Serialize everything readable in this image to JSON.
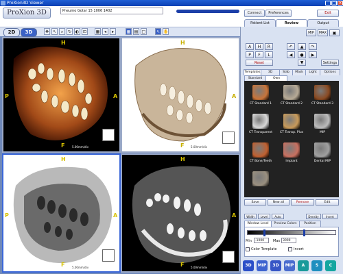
{
  "window": {
    "title": "ProXion3D Viewer",
    "controls": [
      "_",
      "□",
      "×"
    ]
  },
  "header": {
    "logo": "ProXion 3D",
    "file_path": "Pneumo Gotar 15 1006 1402",
    "buttons": {
      "connect": "Connect",
      "preferences": "Preferences",
      "exit": "Exit"
    },
    "tabs": [
      "Patient List",
      "Review",
      "Output"
    ],
    "active_tab": "Review"
  },
  "toolbar": {
    "mode_2d": "2D",
    "mode_3d": "3D"
  },
  "viewports": [
    {
      "name": "viewport-top-left",
      "top": "H",
      "left": "P",
      "right": "A",
      "bottom": "F",
      "scale": "5.00mm/div"
    },
    {
      "name": "viewport-top-right",
      "top": "H",
      "left": "",
      "right": "A",
      "bottom": "F",
      "scale": "5.00mm/div"
    },
    {
      "name": "viewport-bottom-left",
      "top": "H",
      "left": "P",
      "right": "A",
      "bottom": "F",
      "scale": "5.00mm/div"
    },
    {
      "name": "viewport-bottom-right",
      "top": "H",
      "left": "",
      "right": "A",
      "bottom": "F",
      "scale": "5.00mm/div"
    }
  ],
  "panel": {
    "top_buttons": [
      "MIP",
      "MAX"
    ],
    "orient_buttons": [
      "A",
      "H",
      "R",
      "P",
      "F",
      "L"
    ],
    "reset_label": "Reset",
    "settings_label": "Settings",
    "tabs": [
      "Templates",
      "3D Settings",
      "Slab",
      "Mask",
      "Light",
      "Options"
    ],
    "subtabs": [
      "Standard",
      "Own"
    ],
    "active_subtab": "Own",
    "presets": [
      {
        "label": "CT Standard 1",
        "color": "#c8743a"
      },
      {
        "label": "CT Standard 2",
        "color": "#b7aa96"
      },
      {
        "label": "CT Standard 3",
        "color": "#8a4a22"
      },
      {
        "label": "CT Transparent",
        "color": "#d8d8d8"
      },
      {
        "label": "CT Transp. Plus",
        "color": "#c89a5a"
      },
      {
        "label": "MIP",
        "color": "#bcbcbc"
      },
      {
        "label": "CT Bone/Teeth",
        "color": "#c06030"
      },
      {
        "label": "Implant",
        "color": "#c87060"
      },
      {
        "label": "Dental MIP",
        "color": "#a0a0a0"
      },
      {
        "label": "",
        "color": "#9a9080"
      }
    ],
    "preset_actions": [
      "Save",
      "New all",
      "Remove",
      "Edit"
    ],
    "window_tabs": [
      "Window Level",
      "Preview Colors",
      "Position"
    ],
    "mode_buttons": [
      "Width",
      "Level",
      "Auto",
      "Density",
      "Invert"
    ],
    "min_label": "Min",
    "min_value": "-1000",
    "max_label": "Max",
    "max_value": "3000",
    "min_level": 0.18,
    "max_level": 0.62,
    "color_template_label": "Color Template",
    "invert_label": "Invert",
    "bottom_buttons": [
      {
        "label": "3D",
        "color": "#2b4fc8"
      },
      {
        "label": "MIP",
        "color": "#3d63cf"
      },
      {
        "label": "3D",
        "color": "#3756c6"
      },
      {
        "label": "MIP",
        "color": "#4a6ccf"
      },
      {
        "label": "A",
        "color": "#1a9a9a"
      },
      {
        "label": "S",
        "color": "#1e8fbf"
      },
      {
        "label": "C",
        "color": "#15a6a0"
      }
    ]
  }
}
